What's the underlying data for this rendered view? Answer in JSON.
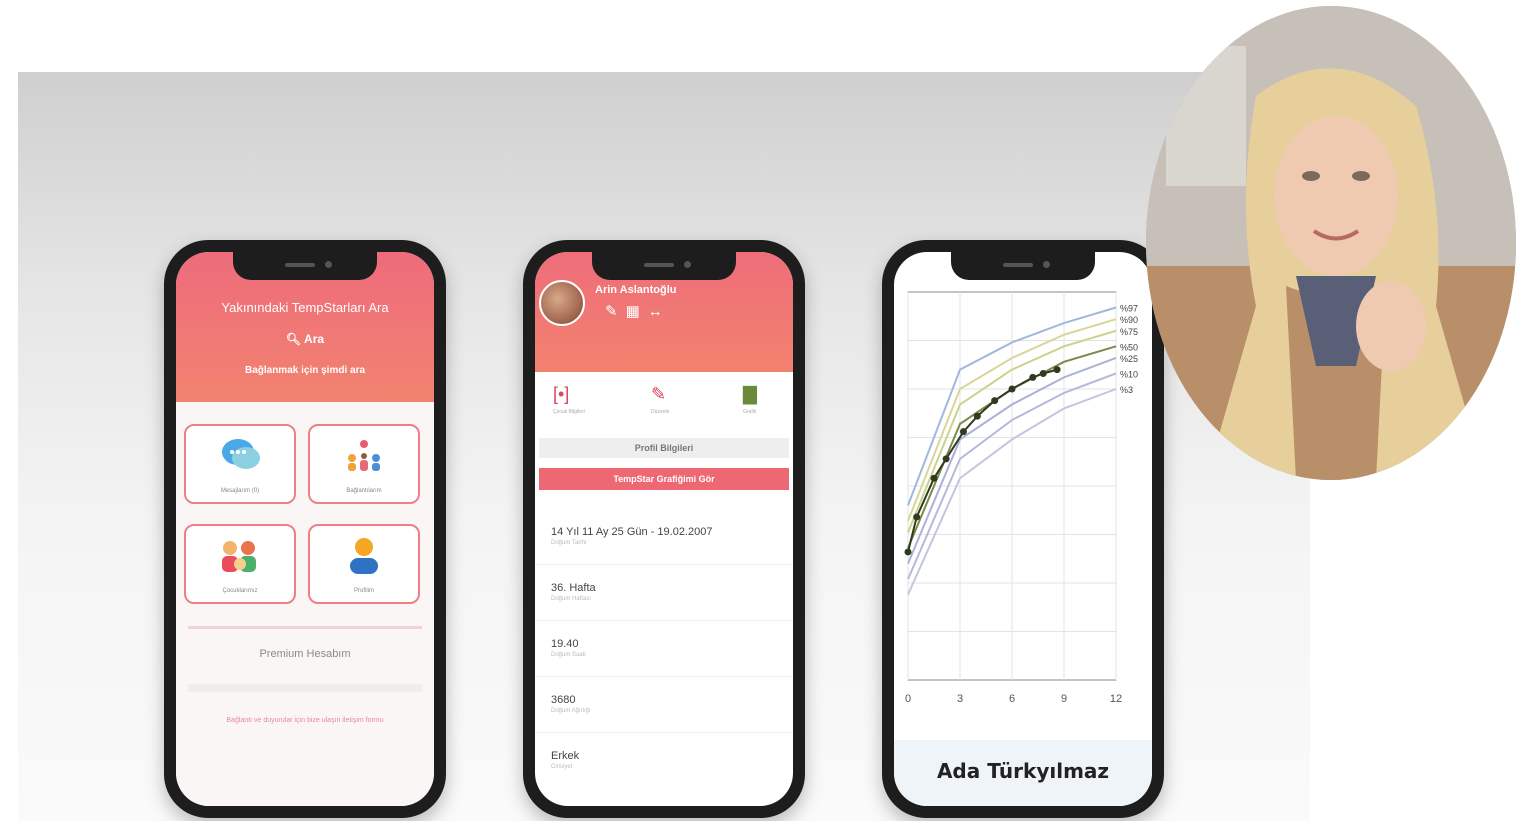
{
  "phone1": {
    "title": "Yakınındaki TempStarları Ara",
    "search_label": "Ara",
    "subtitle": "Bağlanmak için şimdi ara",
    "tiles": [
      {
        "label": "Mesajlarım (0)",
        "icon": "chat-bubbles-icon"
      },
      {
        "label": "Bağlantılarım",
        "icon": "group-connection-icon"
      },
      {
        "label": "Çocuklarımız",
        "icon": "children-icon"
      },
      {
        "label": "Profilim",
        "icon": "person-icon"
      }
    ],
    "account_label": "Premium Hesabım",
    "footer_text": "Bağlantı ve duyurular için bize ulaşın iletişim formu"
  },
  "phone2": {
    "name": "Arin Aslantoğlu",
    "tabs": [
      {
        "label": "Çocuk Bilgileri",
        "icon": "calendar-icon"
      },
      {
        "label": "Düzenle",
        "icon": "pencil-icon"
      },
      {
        "label": "Grafik",
        "icon": "bar-chart-icon"
      }
    ],
    "profile_header": "Profil Bilgileri",
    "graph_button": "TempStar Grafiğimi Gör",
    "rows": [
      {
        "value": "14 Yıl 11 Ay 25 Gün - 19.02.2007",
        "caption": "Doğum Tarihi"
      },
      {
        "value": "36. Hafta",
        "caption": "Doğum Haftası"
      },
      {
        "value": "19.40",
        "caption": "Doğum Saati"
      },
      {
        "value": "3680",
        "caption": "Doğum Ağırlığı"
      },
      {
        "value": "Erkek",
        "caption": "Cinsiyet"
      }
    ]
  },
  "phone3": {
    "name": "Ada Türkyılmaz"
  },
  "chart_data": {
    "type": "line",
    "x_ticks": [
      "0",
      "3",
      "6",
      "9",
      "12"
    ],
    "xlim": [
      0,
      12
    ],
    "ylim": [
      0,
      100
    ],
    "grid": true,
    "series": [
      {
        "name": "%97",
        "color": "#9fb8dc",
        "x": [
          0,
          3,
          6,
          9,
          12
        ],
        "y": [
          45,
          80,
          87,
          92,
          96
        ]
      },
      {
        "name": "%90",
        "color": "#d9d49a",
        "x": [
          0,
          3,
          6,
          9,
          12
        ],
        "y": [
          41,
          75,
          83,
          89,
          93
        ]
      },
      {
        "name": "%75",
        "color": "#c9d38a",
        "x": [
          0,
          3,
          6,
          9,
          12
        ],
        "y": [
          38,
          71,
          80,
          86,
          90
        ]
      },
      {
        "name": "%50",
        "color": "#7a8a4a",
        "x": [
          0,
          3,
          6,
          9,
          12
        ],
        "y": [
          34,
          66,
          75,
          82,
          86
        ]
      },
      {
        "name": "%25",
        "color": "#a8b2d8",
        "x": [
          0,
          3,
          6,
          9,
          12
        ],
        "y": [
          30,
          62,
          71,
          78,
          83
        ]
      },
      {
        "name": "%10",
        "color": "#b3b9db",
        "x": [
          0,
          3,
          6,
          9,
          12
        ],
        "y": [
          26,
          57,
          67,
          74,
          79
        ]
      },
      {
        "name": "%3",
        "color": "#c2c5df",
        "x": [
          0,
          3,
          6,
          9,
          12
        ],
        "y": [
          22,
          52,
          62,
          70,
          75
        ]
      }
    ],
    "measurements": {
      "x": [
        0,
        0.5,
        1.5,
        2.2,
        3.2,
        4,
        5,
        6,
        7.2,
        7.8,
        8.6
      ],
      "y": [
        33,
        42,
        52,
        57,
        64,
        68,
        72,
        75,
        78,
        79,
        80
      ]
    }
  }
}
